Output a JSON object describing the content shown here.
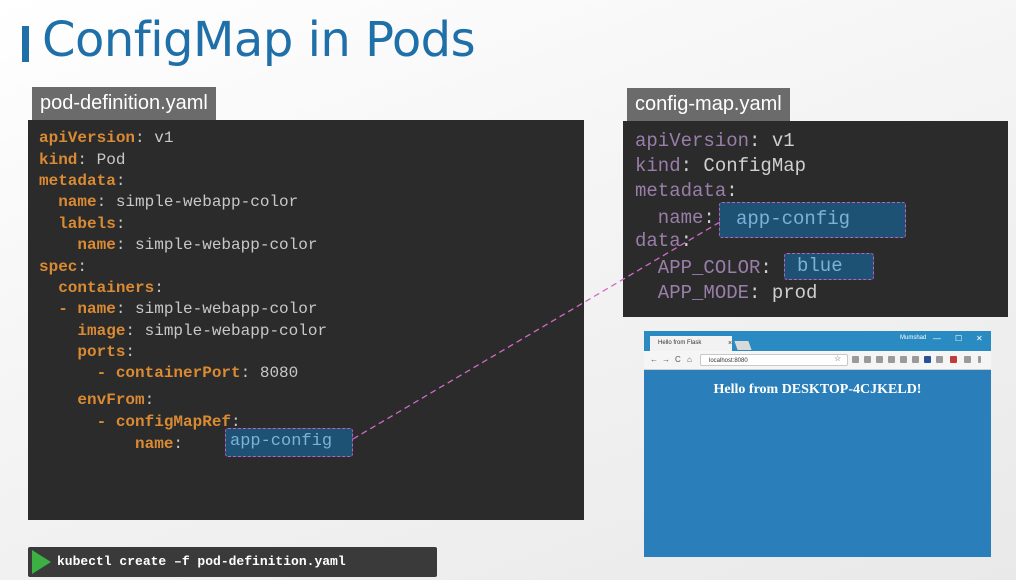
{
  "slide": {
    "title": "ConfigMap in Pods"
  },
  "pod_file": {
    "tab": "pod-definition.yaml",
    "lines": [
      {
        "key": "apiVersion",
        "sep": ": ",
        "value": "v1"
      },
      {
        "key": "kind",
        "sep": ": ",
        "value": "Pod"
      },
      {
        "key": "metadata",
        "sep": ":",
        "value": ""
      },
      {
        "key": "  name",
        "sep": ": ",
        "value": "simple-webapp-color"
      },
      {
        "key": "  labels",
        "sep": ":",
        "value": ""
      },
      {
        "key": "    name",
        "sep": ": ",
        "value": "simple-webapp-color"
      },
      {
        "key": "spec",
        "sep": ":",
        "value": ""
      },
      {
        "key": "  containers",
        "sep": ":",
        "value": ""
      },
      {
        "key": "  - name",
        "sep": ": ",
        "value": "simple-webapp-color"
      },
      {
        "key": "    image",
        "sep": ": ",
        "value": "simple-webapp-color"
      },
      {
        "key": "    ports",
        "sep": ":",
        "value": ""
      },
      {
        "key": "      - containerPort",
        "sep": ": ",
        "value": "8080"
      },
      {
        "key": "    envFrom",
        "sep": ":",
        "value": ""
      },
      {
        "key": "      - configMapRef",
        "sep": ":",
        "value": ""
      },
      {
        "key": "          name",
        "sep": ":",
        "value": ""
      }
    ],
    "highlight": "app-config"
  },
  "configmap_file": {
    "tab": "config-map.yaml",
    "lines": [
      {
        "key": "apiVersion",
        "sep": ": ",
        "value": "v1"
      },
      {
        "key": "kind",
        "sep": ": ",
        "value": "ConfigMap"
      },
      {
        "key": "metadata",
        "sep": ":",
        "value": ""
      },
      {
        "key": "  name",
        "sep": ":",
        "value": ""
      },
      {
        "key": "data",
        "sep": ":",
        "value": ""
      },
      {
        "key": "  APP_COLOR",
        "sep": ":",
        "value": ""
      },
      {
        "key": "  APP_MODE",
        "sep": ": ",
        "value": "prod"
      }
    ],
    "highlight_name": "app-config",
    "highlight_color": "blue"
  },
  "browser": {
    "tab_title": "Hello from Flask",
    "tab_close": "×",
    "user": "Mumshad",
    "minimize": "—",
    "maximize": "☐",
    "close": "✕",
    "back": "←",
    "forward": "→",
    "reload": "C",
    "home": "⌂",
    "address": "localhost:8080",
    "star": "☆",
    "message": "Hello from DESKTOP-4CJKELD!"
  },
  "command": {
    "text": "kubectl create –f pod-definition.yaml"
  },
  "colors": {
    "title": "#1f6fa8",
    "yaml_key_pod": "#d98a33",
    "yaml_key_configmap": "#9a7eaa",
    "code_bg": "#2b2b2b",
    "highlight_bg": "#1e5274",
    "highlight_border": "#c25fb7",
    "browser_bg": "#2a7fba",
    "play_icon": "#3cb043"
  }
}
